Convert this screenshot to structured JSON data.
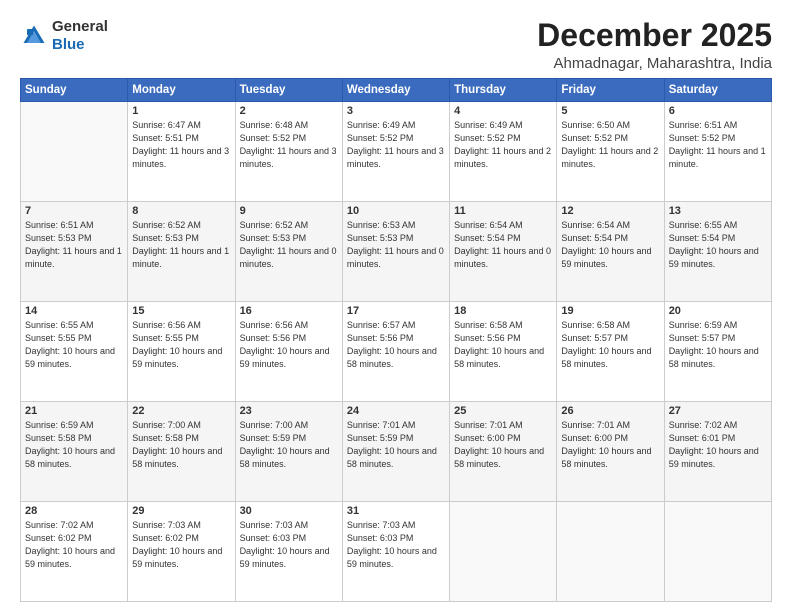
{
  "header": {
    "logo_general": "General",
    "logo_blue": "Blue",
    "month": "December 2025",
    "location": "Ahmadnagar, Maharashtra, India"
  },
  "days_of_week": [
    "Sunday",
    "Monday",
    "Tuesday",
    "Wednesday",
    "Thursday",
    "Friday",
    "Saturday"
  ],
  "weeks": [
    [
      {
        "day": "",
        "detail": ""
      },
      {
        "day": "1",
        "detail": "Sunrise: 6:47 AM\nSunset: 5:51 PM\nDaylight: 11 hours\nand 3 minutes."
      },
      {
        "day": "2",
        "detail": "Sunrise: 6:48 AM\nSunset: 5:52 PM\nDaylight: 11 hours\nand 3 minutes."
      },
      {
        "day": "3",
        "detail": "Sunrise: 6:49 AM\nSunset: 5:52 PM\nDaylight: 11 hours\nand 3 minutes."
      },
      {
        "day": "4",
        "detail": "Sunrise: 6:49 AM\nSunset: 5:52 PM\nDaylight: 11 hours\nand 2 minutes."
      },
      {
        "day": "5",
        "detail": "Sunrise: 6:50 AM\nSunset: 5:52 PM\nDaylight: 11 hours\nand 2 minutes."
      },
      {
        "day": "6",
        "detail": "Sunrise: 6:51 AM\nSunset: 5:52 PM\nDaylight: 11 hours\nand 1 minute."
      }
    ],
    [
      {
        "day": "7",
        "detail": "Sunrise: 6:51 AM\nSunset: 5:53 PM\nDaylight: 11 hours\nand 1 minute."
      },
      {
        "day": "8",
        "detail": "Sunrise: 6:52 AM\nSunset: 5:53 PM\nDaylight: 11 hours\nand 1 minute."
      },
      {
        "day": "9",
        "detail": "Sunrise: 6:52 AM\nSunset: 5:53 PM\nDaylight: 11 hours\nand 0 minutes."
      },
      {
        "day": "10",
        "detail": "Sunrise: 6:53 AM\nSunset: 5:53 PM\nDaylight: 11 hours\nand 0 minutes."
      },
      {
        "day": "11",
        "detail": "Sunrise: 6:54 AM\nSunset: 5:54 PM\nDaylight: 11 hours\nand 0 minutes."
      },
      {
        "day": "12",
        "detail": "Sunrise: 6:54 AM\nSunset: 5:54 PM\nDaylight: 10 hours\nand 59 minutes."
      },
      {
        "day": "13",
        "detail": "Sunrise: 6:55 AM\nSunset: 5:54 PM\nDaylight: 10 hours\nand 59 minutes."
      }
    ],
    [
      {
        "day": "14",
        "detail": "Sunrise: 6:55 AM\nSunset: 5:55 PM\nDaylight: 10 hours\nand 59 minutes."
      },
      {
        "day": "15",
        "detail": "Sunrise: 6:56 AM\nSunset: 5:55 PM\nDaylight: 10 hours\nand 59 minutes."
      },
      {
        "day": "16",
        "detail": "Sunrise: 6:56 AM\nSunset: 5:56 PM\nDaylight: 10 hours\nand 59 minutes."
      },
      {
        "day": "17",
        "detail": "Sunrise: 6:57 AM\nSunset: 5:56 PM\nDaylight: 10 hours\nand 58 minutes."
      },
      {
        "day": "18",
        "detail": "Sunrise: 6:58 AM\nSunset: 5:56 PM\nDaylight: 10 hours\nand 58 minutes."
      },
      {
        "day": "19",
        "detail": "Sunrise: 6:58 AM\nSunset: 5:57 PM\nDaylight: 10 hours\nand 58 minutes."
      },
      {
        "day": "20",
        "detail": "Sunrise: 6:59 AM\nSunset: 5:57 PM\nDaylight: 10 hours\nand 58 minutes."
      }
    ],
    [
      {
        "day": "21",
        "detail": "Sunrise: 6:59 AM\nSunset: 5:58 PM\nDaylight: 10 hours\nand 58 minutes."
      },
      {
        "day": "22",
        "detail": "Sunrise: 7:00 AM\nSunset: 5:58 PM\nDaylight: 10 hours\nand 58 minutes."
      },
      {
        "day": "23",
        "detail": "Sunrise: 7:00 AM\nSunset: 5:59 PM\nDaylight: 10 hours\nand 58 minutes."
      },
      {
        "day": "24",
        "detail": "Sunrise: 7:01 AM\nSunset: 5:59 PM\nDaylight: 10 hours\nand 58 minutes."
      },
      {
        "day": "25",
        "detail": "Sunrise: 7:01 AM\nSunset: 6:00 PM\nDaylight: 10 hours\nand 58 minutes."
      },
      {
        "day": "26",
        "detail": "Sunrise: 7:01 AM\nSunset: 6:00 PM\nDaylight: 10 hours\nand 58 minutes."
      },
      {
        "day": "27",
        "detail": "Sunrise: 7:02 AM\nSunset: 6:01 PM\nDaylight: 10 hours\nand 59 minutes."
      }
    ],
    [
      {
        "day": "28",
        "detail": "Sunrise: 7:02 AM\nSunset: 6:02 PM\nDaylight: 10 hours\nand 59 minutes."
      },
      {
        "day": "29",
        "detail": "Sunrise: 7:03 AM\nSunset: 6:02 PM\nDaylight: 10 hours\nand 59 minutes."
      },
      {
        "day": "30",
        "detail": "Sunrise: 7:03 AM\nSunset: 6:03 PM\nDaylight: 10 hours\nand 59 minutes."
      },
      {
        "day": "31",
        "detail": "Sunrise: 7:03 AM\nSunset: 6:03 PM\nDaylight: 10 hours\nand 59 minutes."
      },
      {
        "day": "",
        "detail": ""
      },
      {
        "day": "",
        "detail": ""
      },
      {
        "day": "",
        "detail": ""
      }
    ]
  ]
}
